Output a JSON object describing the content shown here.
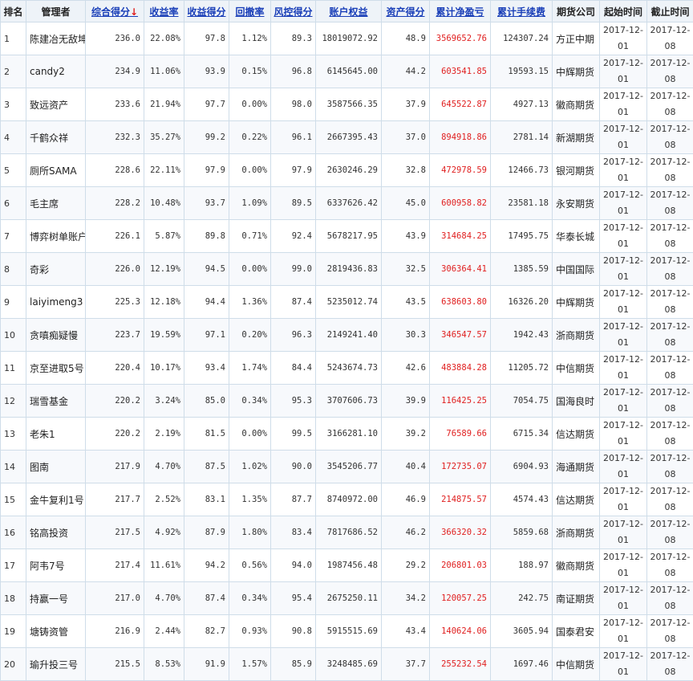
{
  "headers": {
    "rank": "排名",
    "manager": "管理者",
    "composite": "综合得分",
    "sort_arrow": "↓",
    "return_rate": "收益率",
    "return_score": "收益得分",
    "drawdown": "回撤率",
    "risk_score": "风控得分",
    "equity": "账户权益",
    "asset_score": "资产得分",
    "cum_profit": "累计净盈亏",
    "cum_fee": "累计手续费",
    "company": "期货公司",
    "start": "起始时间",
    "end": "截止时间"
  },
  "rows": [
    {
      "rank": "1",
      "name": "陈建冶无敌坤",
      "composite": "236.0",
      "return_rate": "22.08%",
      "return_score": "97.8",
      "drawdown": "1.12%",
      "risk": "89.3",
      "equity": "18019072.92",
      "asset": "48.9",
      "profit": "3569652.76",
      "fee": "124307.24",
      "company": "方正中期",
      "start": [
        "2017-12-",
        "01"
      ],
      "end": [
        "2017-12-",
        "08"
      ]
    },
    {
      "rank": "2",
      "name": "candy2",
      "composite": "234.9",
      "return_rate": "11.06%",
      "return_score": "93.9",
      "drawdown": "0.15%",
      "risk": "96.8",
      "equity": "6145645.00",
      "asset": "44.2",
      "profit": "603541.85",
      "fee": "19593.15",
      "company": "中辉期货",
      "start": [
        "2017-12-",
        "01"
      ],
      "end": [
        "2017-12-",
        "08"
      ]
    },
    {
      "rank": "3",
      "name": "致远资产",
      "composite": "233.6",
      "return_rate": "21.94%",
      "return_score": "97.7",
      "drawdown": "0.00%",
      "risk": "98.0",
      "equity": "3587566.35",
      "asset": "37.9",
      "profit": "645522.87",
      "fee": "4927.13",
      "company": "徽商期货",
      "start": [
        "2017-12-",
        "01"
      ],
      "end": [
        "2017-12-",
        "08"
      ]
    },
    {
      "rank": "4",
      "name": "千鹤众祥",
      "composite": "232.3",
      "return_rate": "35.27%",
      "return_score": "99.2",
      "drawdown": "0.22%",
      "risk": "96.1",
      "equity": "2667395.43",
      "asset": "37.0",
      "profit": "894918.86",
      "fee": "2781.14",
      "company": "新湖期货",
      "start": [
        "2017-12-",
        "01"
      ],
      "end": [
        "2017-12-",
        "08"
      ]
    },
    {
      "rank": "5",
      "name": "厕所SAMA",
      "composite": "228.6",
      "return_rate": "22.11%",
      "return_score": "97.9",
      "drawdown": "0.00%",
      "risk": "97.9",
      "equity": "2630246.29",
      "asset": "32.8",
      "profit": "472978.59",
      "fee": "12466.73",
      "company": "银河期货",
      "start": [
        "2017-12-",
        "01"
      ],
      "end": [
        "2017-12-",
        "08"
      ]
    },
    {
      "rank": "6",
      "name": "毛主席",
      "composite": "228.2",
      "return_rate": "10.48%",
      "return_score": "93.7",
      "drawdown": "1.09%",
      "risk": "89.5",
      "equity": "6337626.42",
      "asset": "45.0",
      "profit": "600958.82",
      "fee": "23581.18",
      "company": "永安期货",
      "start": [
        "2017-12-",
        "01"
      ],
      "end": [
        "2017-12-",
        "08"
      ]
    },
    {
      "rank": "7",
      "name": "博弈树单账户",
      "composite": "226.1",
      "return_rate": "5.87%",
      "return_score": "89.8",
      "drawdown": "0.71%",
      "risk": "92.4",
      "equity": "5678217.95",
      "asset": "43.9",
      "profit": "314684.25",
      "fee": "17495.75",
      "company": "华泰长城",
      "start": [
        "2017-12-",
        "01"
      ],
      "end": [
        "2017-12-",
        "08"
      ]
    },
    {
      "rank": "8",
      "name": "奇彩",
      "composite": "226.0",
      "return_rate": "12.19%",
      "return_score": "94.5",
      "drawdown": "0.00%",
      "risk": "99.0",
      "equity": "2819436.83",
      "asset": "32.5",
      "profit": "306364.41",
      "fee": "1385.59",
      "company": "中国国际",
      "start": [
        "2017-12-",
        "01"
      ],
      "end": [
        "2017-12-",
        "08"
      ]
    },
    {
      "rank": "9",
      "name": "laiyimeng3",
      "composite": "225.3",
      "return_rate": "12.18%",
      "return_score": "94.4",
      "drawdown": "1.36%",
      "risk": "87.4",
      "equity": "5235012.74",
      "asset": "43.5",
      "profit": "638603.80",
      "fee": "16326.20",
      "company": "中辉期货",
      "start": [
        "2017-12-",
        "01"
      ],
      "end": [
        "2017-12-",
        "08"
      ]
    },
    {
      "rank": "10",
      "name": "贪嗔痴疑慢",
      "composite": "223.7",
      "return_rate": "19.59%",
      "return_score": "97.1",
      "drawdown": "0.20%",
      "risk": "96.3",
      "equity": "2149241.40",
      "asset": "30.3",
      "profit": "346547.57",
      "fee": "1942.43",
      "company": "浙商期货",
      "start": [
        "2017-12-",
        "01"
      ],
      "end": [
        "2017-12-",
        "08"
      ]
    },
    {
      "rank": "11",
      "name": "京至进取5号",
      "composite": "220.4",
      "return_rate": "10.17%",
      "return_score": "93.4",
      "drawdown": "1.74%",
      "risk": "84.4",
      "equity": "5243674.73",
      "asset": "42.6",
      "profit": "483884.28",
      "fee": "11205.72",
      "company": "中信期货",
      "start": [
        "2017-12-",
        "01"
      ],
      "end": [
        "2017-12-",
        "08"
      ]
    },
    {
      "rank": "12",
      "name": "瑞雪基金",
      "composite": "220.2",
      "return_rate": "3.24%",
      "return_score": "85.0",
      "drawdown": "0.34%",
      "risk": "95.3",
      "equity": "3707606.73",
      "asset": "39.9",
      "profit": "116425.25",
      "fee": "7054.75",
      "company": "国海良时",
      "start": [
        "2017-12-",
        "01"
      ],
      "end": [
        "2017-12-",
        "08"
      ]
    },
    {
      "rank": "13",
      "name": "老朱1",
      "composite": "220.2",
      "return_rate": "2.19%",
      "return_score": "81.5",
      "drawdown": "0.00%",
      "risk": "99.5",
      "equity": "3166281.10",
      "asset": "39.2",
      "profit": "76589.66",
      "fee": "6715.34",
      "company": "信达期货",
      "start": [
        "2017-12-",
        "01"
      ],
      "end": [
        "2017-12-",
        "08"
      ]
    },
    {
      "rank": "14",
      "name": "图南",
      "composite": "217.9",
      "return_rate": "4.70%",
      "return_score": "87.5",
      "drawdown": "1.02%",
      "risk": "90.0",
      "equity": "3545206.77",
      "asset": "40.4",
      "profit": "172735.07",
      "fee": "6904.93",
      "company": "海通期货",
      "start": [
        "2017-12-",
        "01"
      ],
      "end": [
        "2017-12-",
        "08"
      ]
    },
    {
      "rank": "15",
      "name": "金牛复利1号",
      "composite": "217.7",
      "return_rate": "2.52%",
      "return_score": "83.1",
      "drawdown": "1.35%",
      "risk": "87.7",
      "equity": "8740972.00",
      "asset": "46.9",
      "profit": "214875.57",
      "fee": "4574.43",
      "company": "信达期货",
      "start": [
        "2017-12-",
        "01"
      ],
      "end": [
        "2017-12-",
        "08"
      ]
    },
    {
      "rank": "16",
      "name": "铭高投资",
      "composite": "217.5",
      "return_rate": "4.92%",
      "return_score": "87.9",
      "drawdown": "1.80%",
      "risk": "83.4",
      "equity": "7817686.52",
      "asset": "46.2",
      "profit": "366320.32",
      "fee": "5859.68",
      "company": "浙商期货",
      "start": [
        "2017-12-",
        "01"
      ],
      "end": [
        "2017-12-",
        "08"
      ]
    },
    {
      "rank": "17",
      "name": "阿韦7号",
      "composite": "217.4",
      "return_rate": "11.61%",
      "return_score": "94.2",
      "drawdown": "0.56%",
      "risk": "94.0",
      "equity": "1987456.48",
      "asset": "29.2",
      "profit": "206801.03",
      "fee": "188.97",
      "company": "徽商期货",
      "start": [
        "2017-12-",
        "01"
      ],
      "end": [
        "2017-12-",
        "08"
      ]
    },
    {
      "rank": "18",
      "name": "持赢一号",
      "composite": "217.0",
      "return_rate": "4.70%",
      "return_score": "87.4",
      "drawdown": "0.34%",
      "risk": "95.4",
      "equity": "2675250.11",
      "asset": "34.2",
      "profit": "120057.25",
      "fee": "242.75",
      "company": "南证期货",
      "start": [
        "2017-12-",
        "01"
      ],
      "end": [
        "2017-12-",
        "08"
      ]
    },
    {
      "rank": "19",
      "name": "塘铸资管",
      "composite": "216.9",
      "return_rate": "2.44%",
      "return_score": "82.7",
      "drawdown": "0.93%",
      "risk": "90.8",
      "equity": "5915515.69",
      "asset": "43.4",
      "profit": "140624.06",
      "fee": "3605.94",
      "company": "国泰君安",
      "start": [
        "2017-12-",
        "01"
      ],
      "end": [
        "2017-12-",
        "08"
      ]
    },
    {
      "rank": "20",
      "name": "瑜升投三号",
      "composite": "215.5",
      "return_rate": "8.53%",
      "return_score": "91.9",
      "drawdown": "1.57%",
      "risk": "85.9",
      "equity": "3248485.69",
      "asset": "37.7",
      "profit": "255232.54",
      "fee": "1697.46",
      "company": "中信期货",
      "start": [
        "2017-12-",
        "01"
      ],
      "end": [
        "2017-12-",
        "08"
      ]
    }
  ],
  "colors": {
    "link": "#1a3fb8",
    "profit": "#e02020",
    "header_bg": "#eef3f8",
    "border": "#cfdde9"
  }
}
